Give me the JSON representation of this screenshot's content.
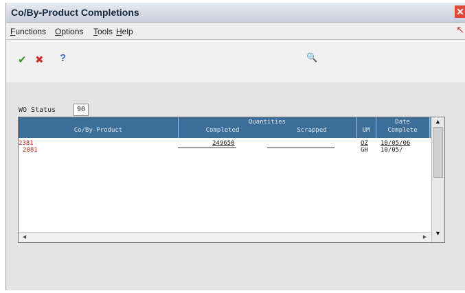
{
  "window": {
    "title": "Co/By-Product Completions",
    "close_glyph": "✕"
  },
  "menu": {
    "items": [
      {
        "first": "F",
        "rest": "unctions"
      },
      {
        "first": "O",
        "rest": "ptions"
      },
      {
        "first": "T",
        "rest": "ools"
      },
      {
        "first": "H",
        "rest": "elp"
      }
    ],
    "arrow_glyph": "↖"
  },
  "toolbar": {
    "ok_glyph": "✔",
    "cancel_glyph": "✖",
    "help_glyph": "?",
    "search_glyph": "🔍"
  },
  "form": {
    "wo_status_label": "WO Status",
    "wo_status_value": "90"
  },
  "grid": {
    "headers": {
      "quantities": "Quantities",
      "product": "Co/By-Product",
      "completed": "Completed",
      "scrapped": "Scrapped",
      "um": "UM",
      "date_top": "Date",
      "date_bottom": "Complete"
    },
    "rows": [
      {
        "product": "2381",
        "completed": "249650",
        "scrapped": "",
        "um": "OZ",
        "date": "10/05/06"
      },
      {
        "product": "2081",
        "completed": "",
        "scrapped": "",
        "um": "GH",
        "date": "10/05/"
      }
    ],
    "scroll": {
      "up": "▲",
      "down": "▼",
      "left": "◄",
      "right": "►"
    }
  }
}
